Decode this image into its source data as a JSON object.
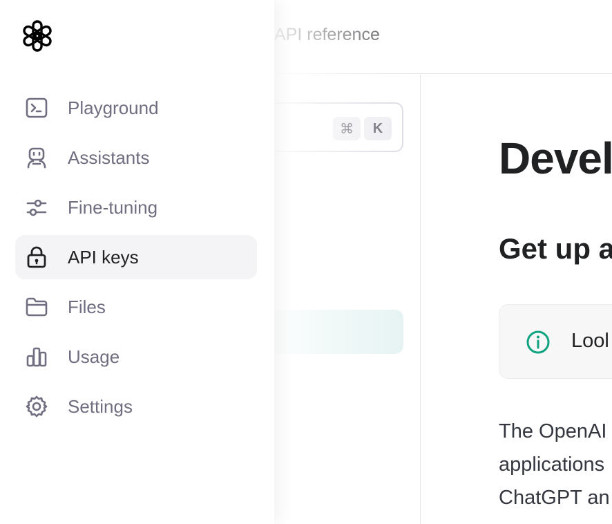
{
  "header": {
    "api_reference": "API reference"
  },
  "search": {
    "shortcut_cmd": "⌘",
    "shortcut_key": "K"
  },
  "content": {
    "title": "Devel",
    "subtitle": "Get up a",
    "callout_text": "Lool",
    "body_lines": [
      "The OpenAI",
      "applications",
      "ChatGPT an"
    ]
  },
  "drawer": {
    "logo": "openai-logo",
    "items": [
      {
        "label": "Playground",
        "icon": "terminal-icon",
        "active": false
      },
      {
        "label": "Assistants",
        "icon": "robot-icon",
        "active": false
      },
      {
        "label": "Fine-tuning",
        "icon": "sliders-icon",
        "active": false
      },
      {
        "label": "API keys",
        "icon": "lock-icon",
        "active": true
      },
      {
        "label": "Files",
        "icon": "folder-icon",
        "active": false
      },
      {
        "label": "Usage",
        "icon": "bar-chart-icon",
        "active": false
      },
      {
        "label": "Settings",
        "icon": "gear-icon",
        "active": false
      }
    ]
  },
  "colors": {
    "accent": "#10a37f",
    "nav_text": "#6e6e80",
    "active_bg": "#f4f4f6",
    "selected_nav_bg": "#e4f2f2"
  }
}
